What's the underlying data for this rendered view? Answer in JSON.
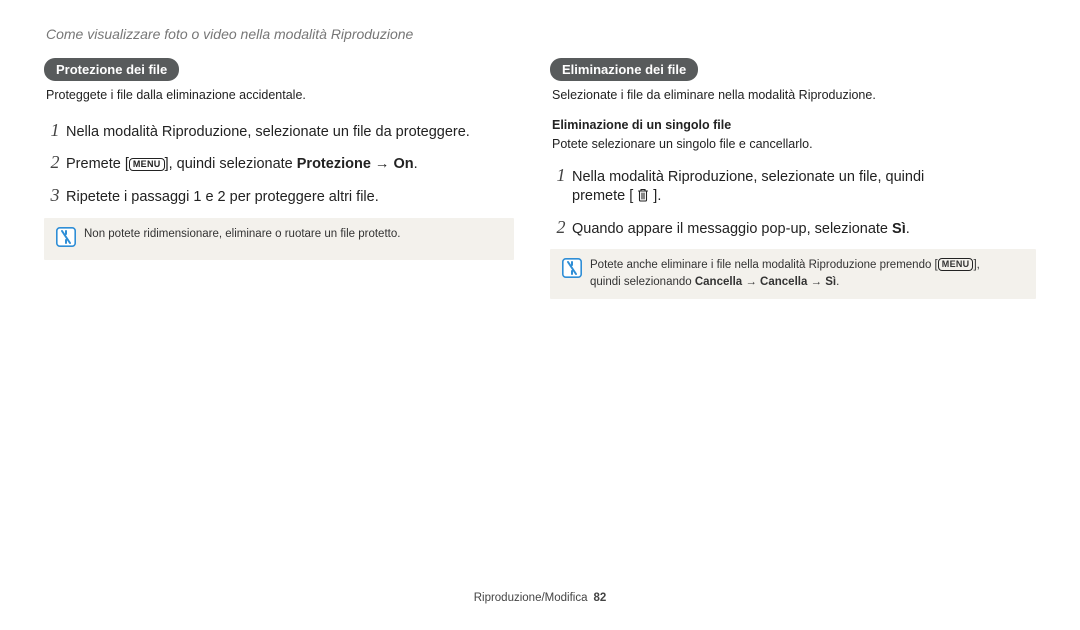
{
  "page_title": "Come visualizzare foto o video nella modalità Riproduzione",
  "left": {
    "pill": "Protezione dei file",
    "intro": "Proteggete i file dalla eliminazione accidentale.",
    "step1": "Nella modalità Riproduzione, selezionate un file da proteggere.",
    "step2_pre": "Premete [",
    "step2_menu": "MENU",
    "step2_mid": "], quindi selezionate ",
    "step2_bold": "Protezione → On",
    "step2_post": ".",
    "step3": "Ripetete i passaggi 1 e 2 per proteggere altri file.",
    "note": "Non potete ridimensionare, eliminare o ruotare un file protetto."
  },
  "right": {
    "pill": "Eliminazione dei file",
    "intro": "Selezionate i file da eliminare nella modalità Riproduzione.",
    "sub_heading": "Eliminazione di un singolo file",
    "sub_intro": "Potete selezionare un singolo file e cancellarlo.",
    "step1_line1": "Nella modalità Riproduzione, selezionate un file, quindi",
    "step1_line2_pre": "premete [ ",
    "step1_line2_post": " ].",
    "step2_pre": "Quando appare il messaggio pop-up, selezionate ",
    "step2_bold": "Sì",
    "step2_post": ".",
    "note_line1_pre": "Potete anche eliminare i file nella modalità Riproduzione premendo [",
    "note_line1_menu": "MENU",
    "note_line1_post": "],",
    "note_line2_pre": "quindi selezionando ",
    "note_line2_bold": "Cancella → Cancella → Sì",
    "note_line2_post": "."
  },
  "footer": {
    "label": "Riproduzione/Modifica",
    "page": "82"
  }
}
